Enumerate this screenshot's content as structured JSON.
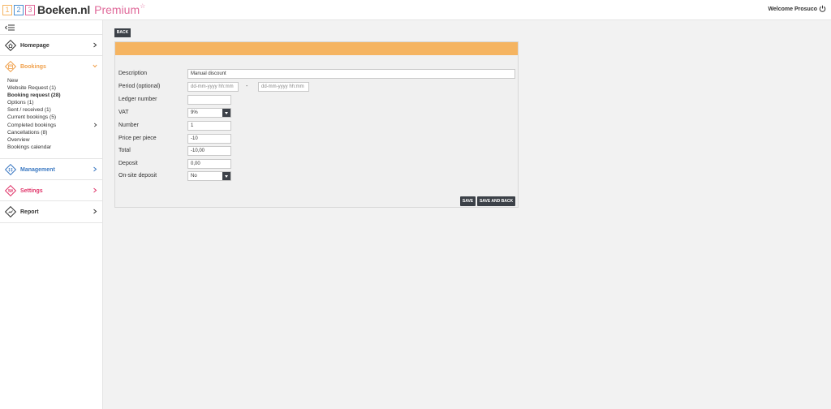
{
  "header": {
    "logo_digits": [
      "1",
      "2",
      "3"
    ],
    "logo_digit_colors": [
      "#f5b461",
      "#4a8fd0",
      "#e06a9a"
    ],
    "logo_text": "Boeken.nl",
    "logo_premium": "Premium",
    "logo_star": "☆",
    "welcome": "Welcome Prosuco"
  },
  "sidebar": {
    "sections": [
      {
        "label": "Homepage",
        "color": "#333333",
        "icon": "home-icon"
      },
      {
        "label": "Bookings",
        "color": "#f0a04b",
        "icon": "bookings-icon",
        "expanded": true
      },
      {
        "label": "Management",
        "color": "#3a78c2",
        "icon": "management-icon"
      },
      {
        "label": "Settings",
        "color": "#e0356a",
        "icon": "settings-icon"
      },
      {
        "label": "Report",
        "color": "#333333",
        "icon": "report-icon"
      }
    ],
    "booking_items": [
      "New",
      "Website Request (1)",
      "Booking request (28)",
      "Options (1)",
      "Sent / received (1)",
      "Current bookings (5)",
      "Completed bookings",
      "Cancellations (8)",
      "Overview",
      "Bookings calendar"
    ]
  },
  "main": {
    "back_label": "BACK",
    "form": {
      "description_label": "Description",
      "description_value": "Manual discount",
      "period_label": "Period (optional)",
      "period_from_placeholder": "dd-mm-yyyy hh:mm",
      "period_separator": "-",
      "period_to_placeholder": "dd-mm-yyyy hh:mm",
      "ledger_label": "Ledger number",
      "ledger_value": "",
      "vat_label": "VAT",
      "vat_value": "9%",
      "number_label": "Number",
      "number_value": "1",
      "price_label": "Price per piece",
      "price_value": "-10",
      "total_label": "Total",
      "total_value": "-10,00",
      "deposit_label": "Deposit",
      "deposit_value": "0,00",
      "onsite_label": "On-site deposit",
      "onsite_value": "No"
    },
    "save_label": "SAVE",
    "save_back_label": "SAVE AND BACK"
  }
}
